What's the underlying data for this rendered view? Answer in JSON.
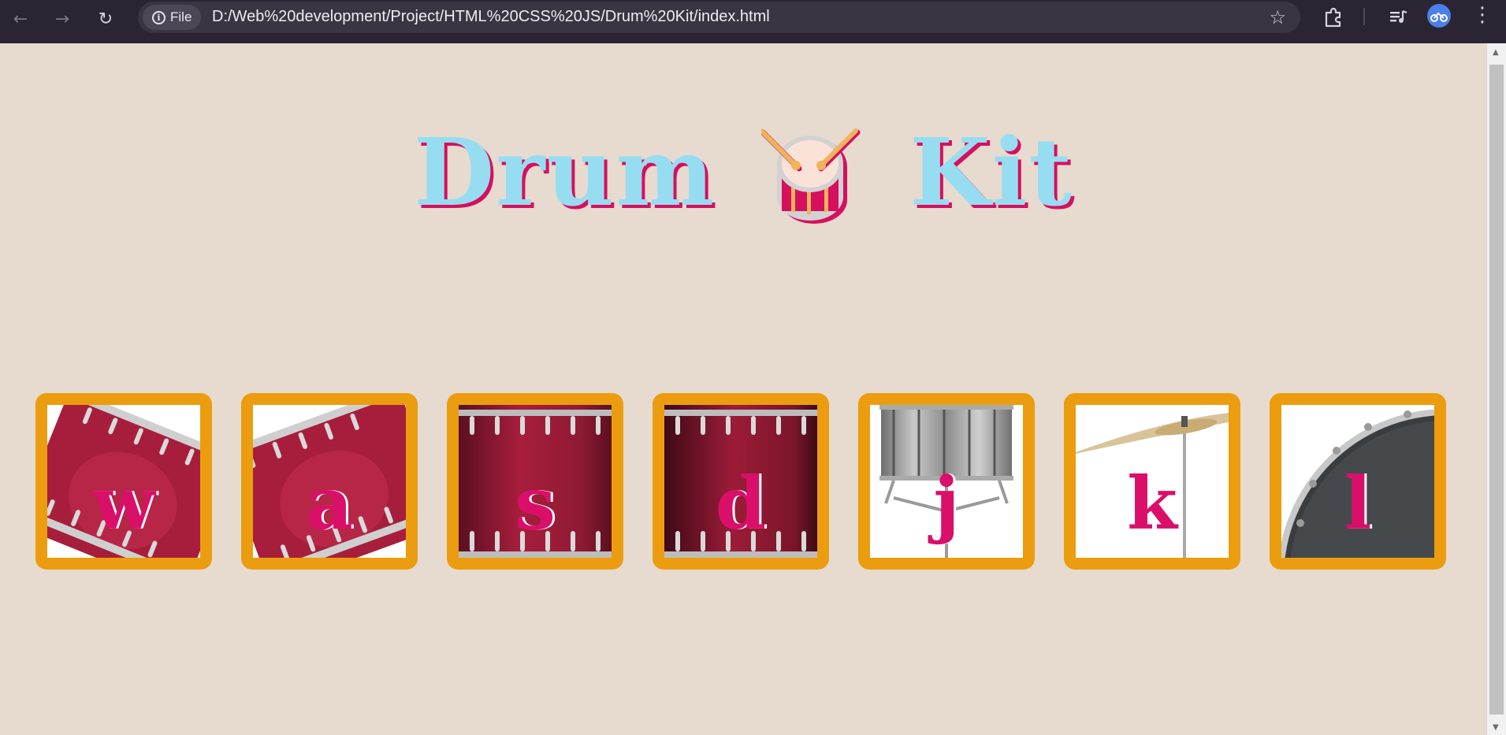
{
  "browser": {
    "chip_label": "File",
    "url": "D:/Web%20development/Project/HTML%20CSS%20JS/Drum%20Kit/index.html",
    "icons": [
      "back-icon",
      "forward-icon",
      "reload-icon",
      "info-icon",
      "star-icon",
      "extensions-icon",
      "media-icon",
      "profile-icon",
      "menu-icon"
    ]
  },
  "page": {
    "title_left": "Drum",
    "title_right": "Kit",
    "colors": {
      "background": "#e7dacf",
      "title_fill": "#97ddf2",
      "title_shadow": "#d60f5f",
      "key_color": "#da0f6a",
      "button_border": "#eb9d0f"
    },
    "drums": [
      {
        "key": "w",
        "image": "tom-rotated"
      },
      {
        "key": "a",
        "image": "tom-rotated-alt"
      },
      {
        "key": "s",
        "image": "tom-upright"
      },
      {
        "key": "d",
        "image": "tom-upright-dark"
      },
      {
        "key": "j",
        "image": "snare"
      },
      {
        "key": "k",
        "image": "cymbal"
      },
      {
        "key": "l",
        "image": "kick"
      }
    ]
  }
}
